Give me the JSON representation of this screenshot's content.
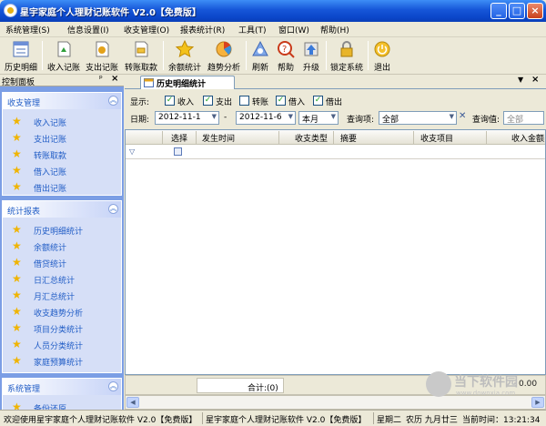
{
  "window": {
    "title": "星宇家庭个人理财记账软件 V2.0【免费版】"
  },
  "menu": [
    "系统管理(S)",
    "信息设置(I)",
    "收支管理(O)",
    "报表统计(R)",
    "工具(T)",
    "窗口(W)",
    "帮助(H)"
  ],
  "toolbar": [
    "历史明细",
    "收入记账",
    "支出记账",
    "转账取款",
    "余额统计",
    "趋势分析",
    "刷新",
    "帮助",
    "升级",
    "锁定系统",
    "退出"
  ],
  "left_panel": {
    "title": "控制面板",
    "groups": [
      {
        "title": "收支管理",
        "items": [
          "收入记账",
          "支出记账",
          "转账取款",
          "借入记账",
          "借出记账"
        ]
      },
      {
        "title": "统计报表",
        "items": [
          "历史明细统计",
          "余额统计",
          "借贷统计",
          "日汇总统计",
          "月汇总统计",
          "收支趋势分析",
          "项目分类统计",
          "人员分类统计",
          "家庭预算统计"
        ]
      },
      {
        "title": "系统管理",
        "items": [
          "备份还原"
        ]
      }
    ]
  },
  "tab": {
    "label": "历史明细统计"
  },
  "filter": {
    "show_label": "显示:",
    "checks": [
      "收入",
      "支出",
      "转账",
      "借入",
      "借出"
    ],
    "checked": [
      true,
      true,
      false,
      true,
      true
    ],
    "date_label": "日期:",
    "date_from": "2012-11-1",
    "date_to": "2012-11-6",
    "period": "本月",
    "query_item_label": "查询项:",
    "query_item": "全部",
    "query_value_label": "查询值:",
    "query_value_placeholder": "全部"
  },
  "grid": {
    "columns": [
      "选择",
      "发生时间",
      "收支类型",
      "摘要",
      "收支项目",
      "收入金额"
    ]
  },
  "summary": {
    "label": "合计:(0)",
    "value": "0.00"
  },
  "watermark": {
    "text": "当下软件园",
    "sub": "www.downxia.com"
  },
  "statusbar": {
    "welcome": "欢迎使用星宇家庭个人理财记账软件 V2.0【免费版】",
    "product": "星宇家庭个人理财记账软件 V2.0【免费版】",
    "weekday": "星期二",
    "lunar": "农历 九月廿三",
    "time_label": "当前时间：13:21:34"
  }
}
